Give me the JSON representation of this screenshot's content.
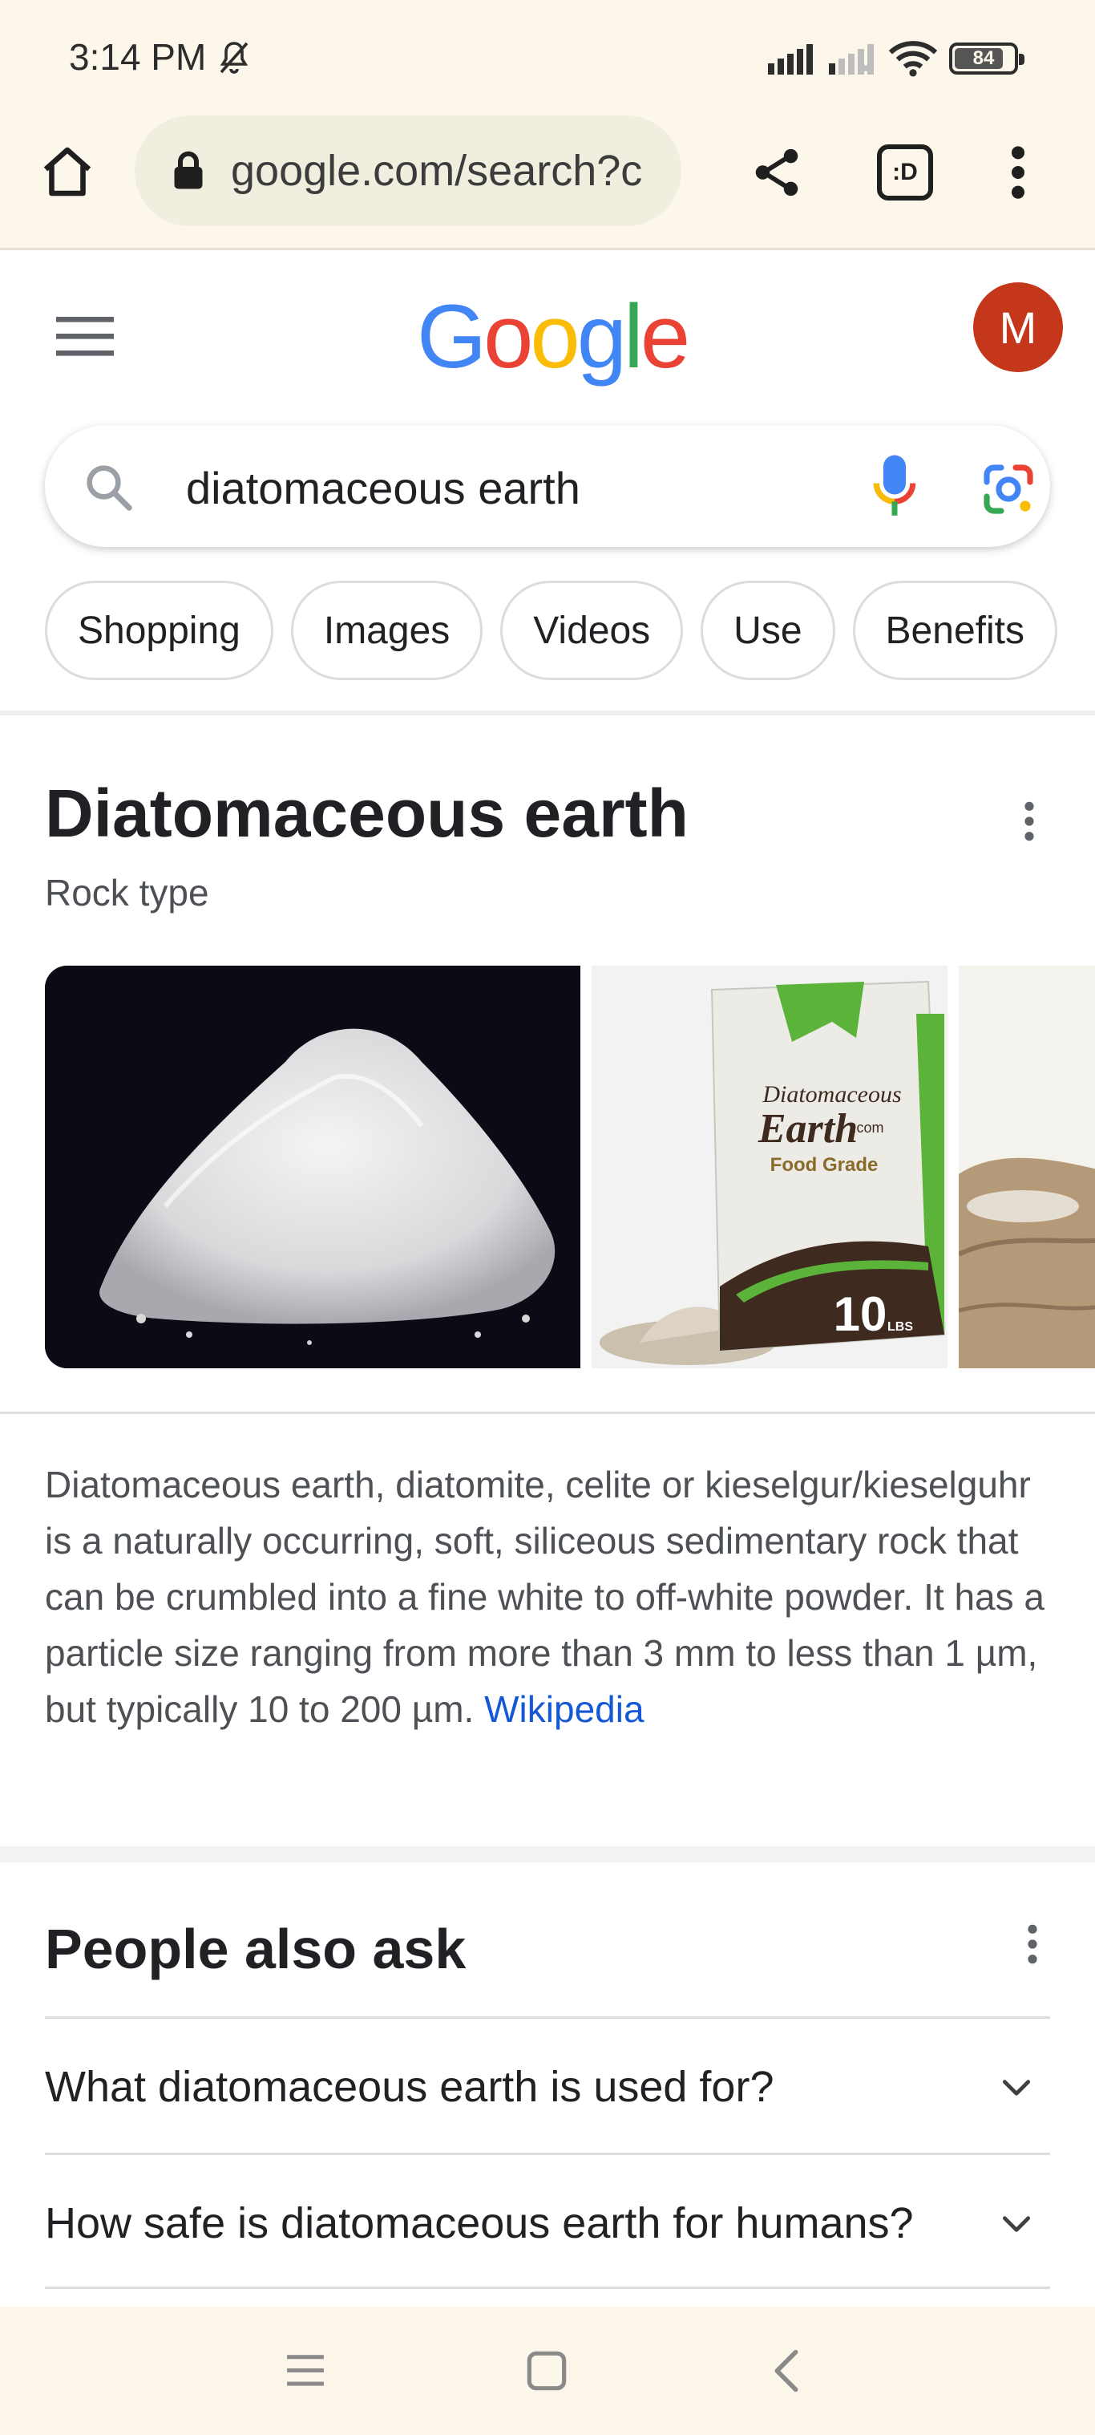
{
  "status_bar": {
    "time": "3:14 PM",
    "battery_text": "84",
    "battery_level": 0.84,
    "icons": [
      "bell-off-icon",
      "signal-icon",
      "signal-weak-icon",
      "wifi-icon",
      "battery-icon"
    ]
  },
  "browser": {
    "url": "google.com/search?c",
    "icons": [
      "home-icon",
      "lock-icon",
      "share-icon",
      "tab-switcher-icon",
      "more-vert-icon"
    ],
    "tab_label": ":D"
  },
  "google": {
    "logo": [
      "G",
      "o",
      "o",
      "g",
      "l",
      "e"
    ],
    "logo_colors": [
      "#4285f4",
      "#ea4335",
      "#fbbc05",
      "#4285f4",
      "#34a853",
      "#ea4335"
    ],
    "avatar_letter": "M",
    "avatar_color": "#c5371b"
  },
  "search": {
    "query": "diatomaceous earth",
    "icons": [
      "search-icon",
      "mic-icon",
      "lens-icon"
    ]
  },
  "chips": [
    "Shopping",
    "Images",
    "Videos",
    "Use",
    "Benefits"
  ],
  "knowledge_panel": {
    "title": "Diatomaceous earth",
    "subtitle": "Rock type",
    "images": [
      {
        "name": "powder-pile-image",
        "label": ""
      },
      {
        "name": "product-bag-image",
        "brand": "Diatomaceous",
        "brand2": "Earth",
        "brand_suffix": ".com",
        "grade": "Food Grade",
        "weight": "10",
        "weight_unit": "LBS"
      },
      {
        "name": "bag-on-wood-image",
        "label": ""
      }
    ],
    "description": "Diatomaceous earth, diatomite, celite or kieselgur/kieselguhr is a naturally occurring, soft, siliceous sedimentary rock that can be crumbled into a fine white to off-white powder. It has a particle size ranging from more than 3 mm to less than 1 µm, but typically 10 to 200 µm.",
    "source": "Wikipedia"
  },
  "people_also_ask": {
    "title": "People also ask",
    "questions": [
      "What diatomaceous earth is used for?",
      "How safe is diatomaceous earth for humans?"
    ]
  },
  "nav_bar": {
    "icons": [
      "recents-icon",
      "home-square-icon",
      "back-icon"
    ]
  }
}
